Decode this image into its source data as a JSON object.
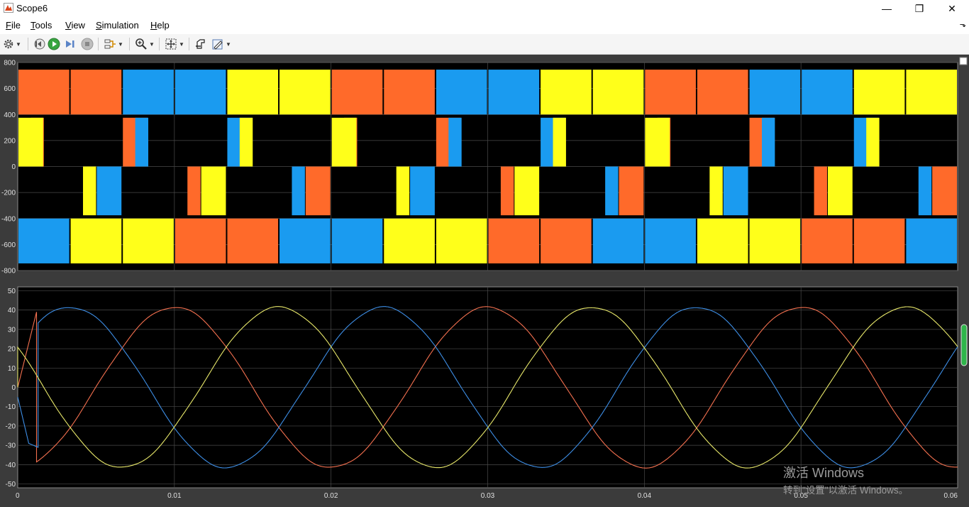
{
  "window": {
    "title": "Scope6",
    "minimize_glyph": "—",
    "maximize_glyph": "❐",
    "close_glyph": "✕"
  },
  "menu": {
    "items": [
      {
        "label": "File",
        "mnemonic": "F",
        "rest": "ile"
      },
      {
        "label": "Tools",
        "mnemonic": "T",
        "rest": "ools"
      },
      {
        "label": "View",
        "mnemonic": "V",
        "rest": "iew"
      },
      {
        "label": "Simulation",
        "mnemonic": "S",
        "rest": "imulation"
      },
      {
        "label": "Help",
        "mnemonic": "H",
        "rest": "elp"
      }
    ],
    "overflow_glyph": "⬎"
  },
  "toolbar": {
    "icons": [
      "gear-icon",
      "step-back-icon",
      "run-icon",
      "step-forward-icon",
      "stop-icon",
      "signal-select-icon",
      "zoom-icon",
      "fit-axes-icon",
      "cursor-icon",
      "edit-style-icon"
    ]
  },
  "colors": {
    "phase_orange": "#ff6a2a",
    "phase_blue": "#1a9bf0",
    "phase_yellow": "#ffff1a",
    "current_red": "#f4704f",
    "current_blue": "#3d8ee6",
    "current_yellow": "#e8e86a",
    "plot_bg": "#000000",
    "grid": "#4a4a4a"
  },
  "watermark": {
    "line1": "激活 Windows",
    "line2": "转到\"设置\"以激活 Windows。"
  },
  "chart_data": [
    {
      "type": "area",
      "title": "",
      "xlim": [
        0,
        0.06
      ],
      "ylim": [
        -800,
        800
      ],
      "yticks": [
        800,
        600,
        400,
        200,
        0,
        -200,
        -400,
        -600,
        -800
      ],
      "ytick_labels": [
        "800",
        "600",
        "400",
        "200",
        "0",
        "-200",
        "-400",
        "-600",
        "-800"
      ],
      "period": 0.02,
      "pwm_levels": [
        {
          "range": [
            400,
            745
          ]
        },
        {
          "range": [
            0,
            375
          ]
        },
        {
          "range": [
            -375,
            0
          ]
        },
        {
          "range": [
            -745,
            -400
          ]
        }
      ],
      "series": [
        {
          "color": "orange",
          "phase_deg": 0
        },
        {
          "color": "blue",
          "phase_deg": -120
        },
        {
          "color": "yellow",
          "phase_deg": 120
        }
      ]
    },
    {
      "type": "line",
      "title": "",
      "xlim": [
        0,
        0.06
      ],
      "ylim": [
        -52,
        52
      ],
      "xticks": [
        0,
        0.01,
        0.02,
        0.03,
        0.04,
        0.05,
        0.06
      ],
      "xtick_labels": [
        "0",
        "0.01",
        "0.02",
        "0.03",
        "0.04",
        "0.05",
        "0.06"
      ],
      "yticks": [
        50,
        40,
        30,
        20,
        10,
        0,
        -10,
        -20,
        -30,
        -40,
        -50
      ],
      "ytick_labels": [
        "50",
        "40",
        "30",
        "20",
        "10",
        "0",
        "-10",
        "-20",
        "-30",
        "-40",
        "-50"
      ],
      "series": [
        {
          "color": "red",
          "amplitude": 41.5,
          "frequency": 50,
          "phase_deg": 270,
          "start_points": [
            [
              0,
              0
            ],
            [
              0.0012,
              39
            ]
          ]
        },
        {
          "color": "blue",
          "amplitude": 41.5,
          "frequency": 50,
          "phase_deg": 30,
          "start_points": [
            [
              0,
              -5
            ],
            [
              0.0007,
              -29
            ],
            [
              0.0013,
              -31
            ]
          ]
        },
        {
          "color": "yellow",
          "amplitude": 41.5,
          "frequency": 50,
          "phase_deg": 150,
          "start_points": [
            [
              0,
              0
            ]
          ]
        }
      ]
    }
  ]
}
